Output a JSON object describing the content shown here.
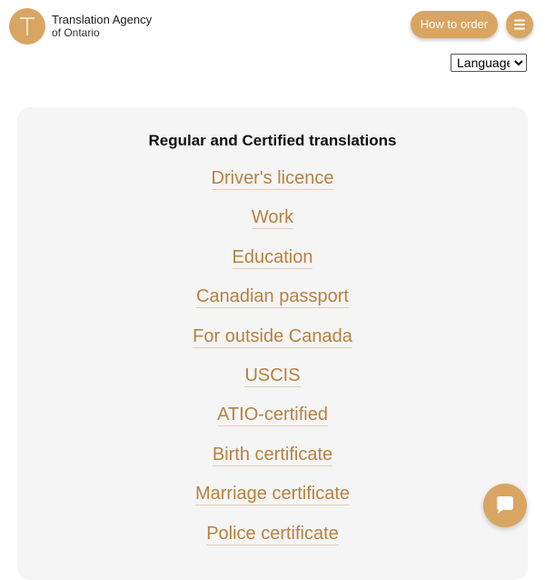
{
  "brand": {
    "logo_letter": "T",
    "name_line1": "Translation Agency",
    "name_line2": "of Ontario",
    "accent_color": "#d9a562",
    "link_color": "#b8813f"
  },
  "header": {
    "order_button_label": "How to order",
    "menu_icon": "hamburger-icon"
  },
  "language_select": {
    "selected": "Language"
  },
  "panel": {
    "title": "Regular and Certified translations",
    "links": [
      "Driver's licence",
      "Work",
      "Education",
      "Canadian passport",
      "For outside Canada",
      "USCIS",
      "ATIO-certified",
      "Birth certificate",
      "Marriage certificate",
      "Police certificate"
    ]
  },
  "chat": {
    "icon": "chat-bubble-icon"
  }
}
